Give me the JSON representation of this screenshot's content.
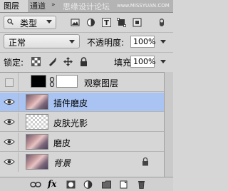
{
  "tabs": [
    {
      "label": "图层",
      "active": true
    },
    {
      "label": "通道",
      "active": false
    }
  ],
  "watermark": {
    "text": "思缘设计论坛",
    "url": "www.MISSYUAN.COM"
  },
  "filter": {
    "type_label": "类型",
    "icons": [
      "image-filter-icon",
      "adjustment-filter-icon",
      "type-filter-icon",
      "shape-filter-icon",
      "smart-object-filter-icon",
      "filter-toggle-icon"
    ]
  },
  "blend": {
    "mode": "正常",
    "opacity_label": "不透明度:",
    "opacity_value": "100%"
  },
  "lock": {
    "label": "锁定:",
    "icons": [
      "lock-transparent-icon",
      "lock-image-icon",
      "lock-position-icon",
      "lock-all-icon"
    ],
    "fill_label": "填充:",
    "fill_value": "100%"
  },
  "layers": [
    {
      "name": "观察图层",
      "visible": false,
      "selected": false,
      "kind": "adjustment"
    },
    {
      "name": "插件磨皮",
      "visible": true,
      "selected": true,
      "kind": "photo"
    },
    {
      "name": "皮肤光影",
      "visible": true,
      "selected": false,
      "kind": "transparent"
    },
    {
      "name": "磨皮",
      "visible": true,
      "selected": false,
      "kind": "photo"
    },
    {
      "name": "背景",
      "visible": true,
      "selected": false,
      "kind": "photo",
      "locked": true
    }
  ],
  "bottom_icons": [
    "link-icon",
    "fx-icon",
    "mask-icon",
    "adjustment-icon",
    "group-icon",
    "new-layer-icon",
    "trash-icon"
  ],
  "fx_label": "fx",
  "colors": {
    "selected_row": "#a9c4f3",
    "panel_bg": "#d6d6d6"
  }
}
